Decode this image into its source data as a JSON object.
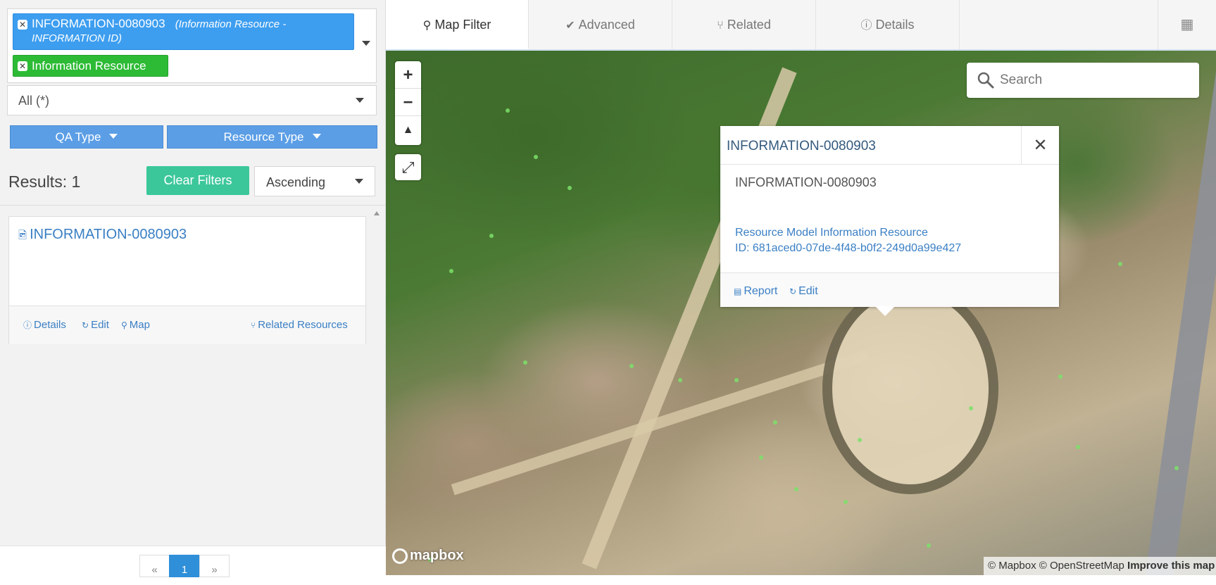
{
  "search_terms": {
    "chips": [
      {
        "label": "INFORMATION-0080903",
        "sub": "(Information Resource - INFORMATION ID)",
        "color": "#3d9ef0"
      },
      {
        "label": "Information Resource",
        "color": "#2dbb35"
      }
    ]
  },
  "filter_select": {
    "value": "All (*)"
  },
  "filter_buttons": {
    "qa_type": "QA Type",
    "resource_type": "Resource Type"
  },
  "results": {
    "label": "Results: 1",
    "clear_filters": "Clear Filters",
    "sort": "Ascending",
    "items": [
      {
        "title": "INFORMATION-0080903",
        "actions": {
          "details": "Details",
          "edit": "Edit",
          "map": "Map",
          "related": "Related Resources"
        }
      }
    ]
  },
  "pagination": {
    "prev": "«",
    "current": "1",
    "next": "»"
  },
  "tabs": [
    {
      "label": "Map Filter",
      "icon": "map-marker-icon",
      "active": true
    },
    {
      "label": "Advanced",
      "icon": "check-circle-icon"
    },
    {
      "label": "Related",
      "icon": "branch-icon"
    },
    {
      "label": "Details",
      "icon": "info-circle-icon"
    }
  ],
  "map": {
    "search_placeholder": "Search",
    "popup": {
      "title": "INFORMATION-0080903",
      "name": "INFORMATION-0080903",
      "model_line": "Resource Model Information Resource",
      "id_line": "ID: 681aced0-07de-4f48-b0f2-249d0a99e427",
      "report": "Report",
      "edit": "Edit"
    },
    "logo": "mapbox",
    "attribution": {
      "text": "© Mapbox © OpenStreetMap",
      "improve": "Improve this map"
    }
  },
  "colors": {
    "accent": "#3a7fc4",
    "clear_filters": "#3cc79a",
    "filter_btn": "#5b9ee6"
  }
}
